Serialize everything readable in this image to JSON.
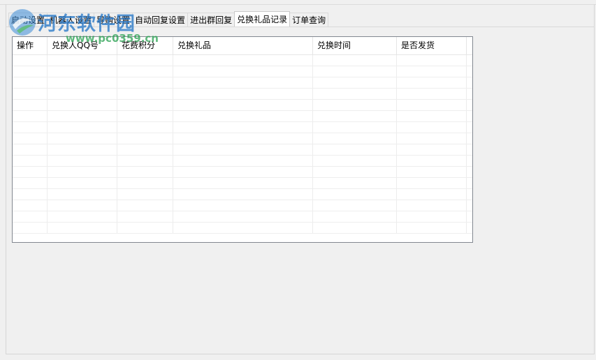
{
  "tabs": [
    {
      "label": "启动设置",
      "active": false
    },
    {
      "label": "机器人设置",
      "active": false
    },
    {
      "label": "导购设置",
      "active": false
    },
    {
      "label": "自动回复设置",
      "active": false
    },
    {
      "label": "进出群回复",
      "active": false
    },
    {
      "label": "兑换礼品记录",
      "active": true
    },
    {
      "label": "订单查询",
      "active": false
    }
  ],
  "grid": {
    "columns": [
      "操作",
      "兑换人QQ号",
      "花费积分",
      "兑换礼品",
      "兑换时间",
      "是否发货"
    ],
    "rows": []
  },
  "watermark": {
    "title": "河东软件园",
    "url": "www.pc0359.cn"
  }
}
